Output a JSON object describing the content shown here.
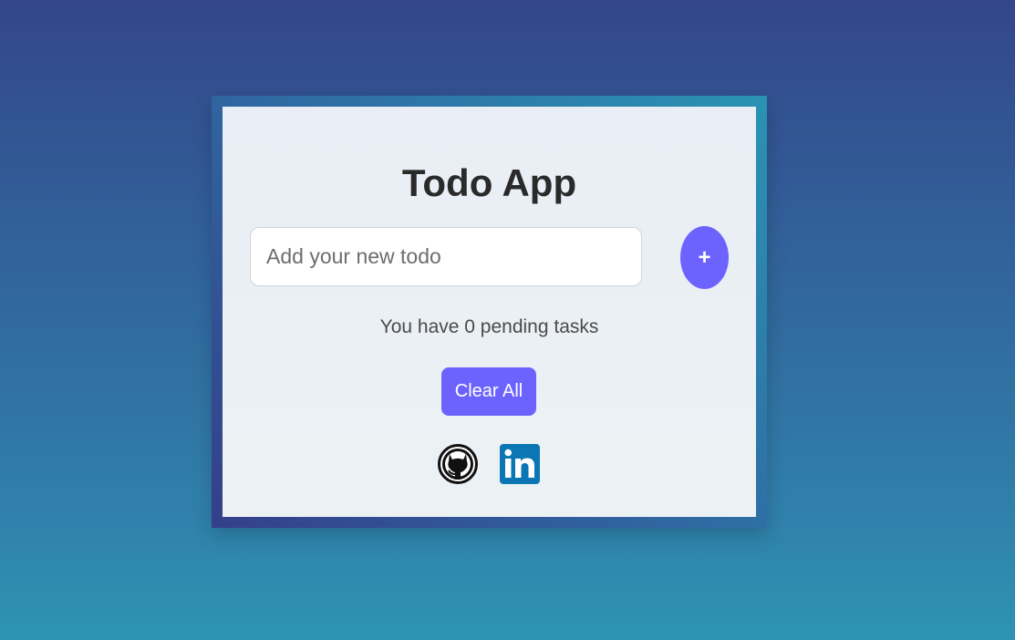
{
  "app": {
    "title": "Todo App"
  },
  "input": {
    "placeholder": "Add your new todo",
    "value": ""
  },
  "add_button": {
    "label": "+"
  },
  "pending": {
    "text": "You have 0 pending tasks"
  },
  "clear_button": {
    "label": "Clear All"
  },
  "social": [
    {
      "icon": "github-icon"
    },
    {
      "icon": "linkedin-icon"
    }
  ],
  "colors": {
    "accent": "#6c63ff",
    "linkedin": "#0a76b4",
    "title": "#2a2a2a",
    "bg_top": "#33468a",
    "bg_bottom": "#2e94b2"
  }
}
